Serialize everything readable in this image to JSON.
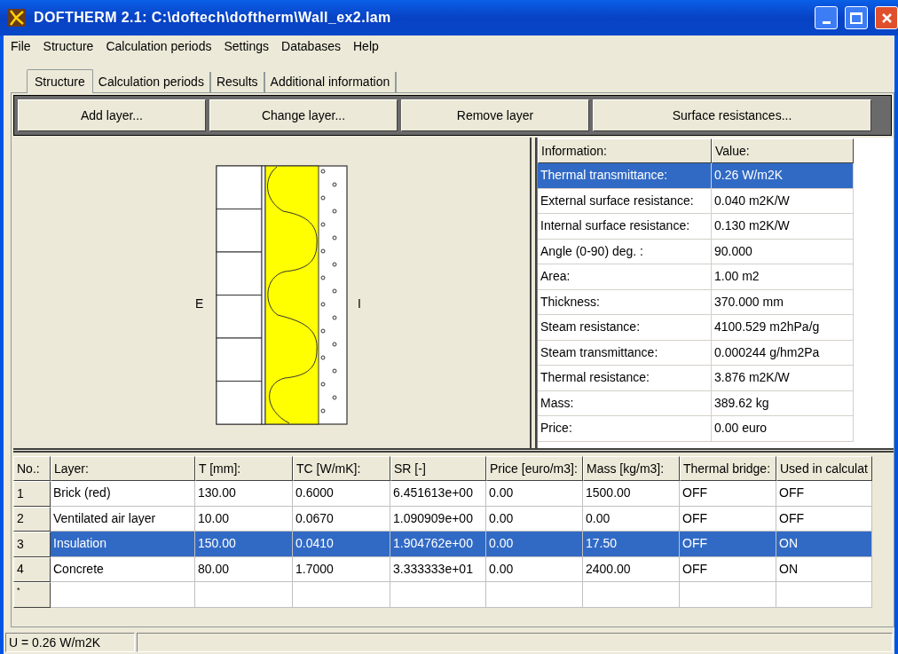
{
  "window": {
    "title": "DOFTHERM 2.1: C:\\doftech\\doftherm\\Wall_ex2.lam"
  },
  "menu": [
    "File",
    "Structure",
    "Calculation periods",
    "Settings",
    "Databases",
    "Help"
  ],
  "tabs": [
    {
      "label": "Structure",
      "selected": true
    },
    {
      "label": "Calculation periods",
      "selected": false
    },
    {
      "label": "Results",
      "selected": false
    },
    {
      "label": "Additional information",
      "selected": false
    }
  ],
  "toolbar": [
    "Add layer...",
    "Change layer...",
    "Remove layer",
    "Surface resistances..."
  ],
  "drawing": {
    "left_label": "E",
    "right_label": "I"
  },
  "info_table": {
    "columns": [
      "Information:",
      "Value:"
    ],
    "rows": [
      {
        "label": "Thermal transmittance:",
        "value": "0.26 W/m2K",
        "selected": true
      },
      {
        "label": "External surface resistance:",
        "value": "0.040 m2K/W",
        "selected": false
      },
      {
        "label": "Internal surface resistance:",
        "value": "0.130 m2K/W",
        "selected": false
      },
      {
        "label": "Angle (0-90) deg. :",
        "value": "90.000",
        "selected": false
      },
      {
        "label": "Area:",
        "value": "1.00 m2",
        "selected": false
      },
      {
        "label": "Thickness:",
        "value": "370.000 mm",
        "selected": false
      },
      {
        "label": "Steam resistance:",
        "value": "4100.529 m2hPa/g",
        "selected": false
      },
      {
        "label": "Steam transmittance:",
        "value": "0.000244 g/hm2Pa",
        "selected": false
      },
      {
        "label": "Thermal resistance:",
        "value": "3.876 m2K/W",
        "selected": false
      },
      {
        "label": "Mass:",
        "value": "389.62 kg",
        "selected": false
      },
      {
        "label": "Price:",
        "value": "0.00 euro",
        "selected": false
      }
    ]
  },
  "layers_table": {
    "columns": [
      "No.:",
      "Layer:",
      "T [mm]:",
      "TC [W/mK]:",
      "SR [-]",
      "Price [euro/m3]:",
      "Mass [kg/m3]:",
      "Thermal bridge:",
      "Used in calculat"
    ],
    "rows": [
      {
        "cells": [
          "1",
          "Brick (red)",
          "130.00",
          "0.6000",
          "6.451613e+00",
          "0.00",
          "1500.00",
          "OFF",
          "OFF"
        ],
        "selected": false
      },
      {
        "cells": [
          "2",
          "Ventilated air layer",
          "10.00",
          "0.0670",
          "1.090909e+00",
          "0.00",
          "0.00",
          "OFF",
          "OFF"
        ],
        "selected": false
      },
      {
        "cells": [
          "3",
          "Insulation",
          "150.00",
          "0.0410",
          "1.904762e+00",
          "0.00",
          "17.50",
          "OFF",
          "ON"
        ],
        "selected": true
      },
      {
        "cells": [
          "4",
          "Concrete",
          "80.00",
          "1.7000",
          "3.333333e+01",
          "0.00",
          "2400.00",
          "OFF",
          "ON"
        ],
        "selected": false
      }
    ],
    "new_row_marker": "*"
  },
  "status_bar": "U = 0.26 W/m2K"
}
